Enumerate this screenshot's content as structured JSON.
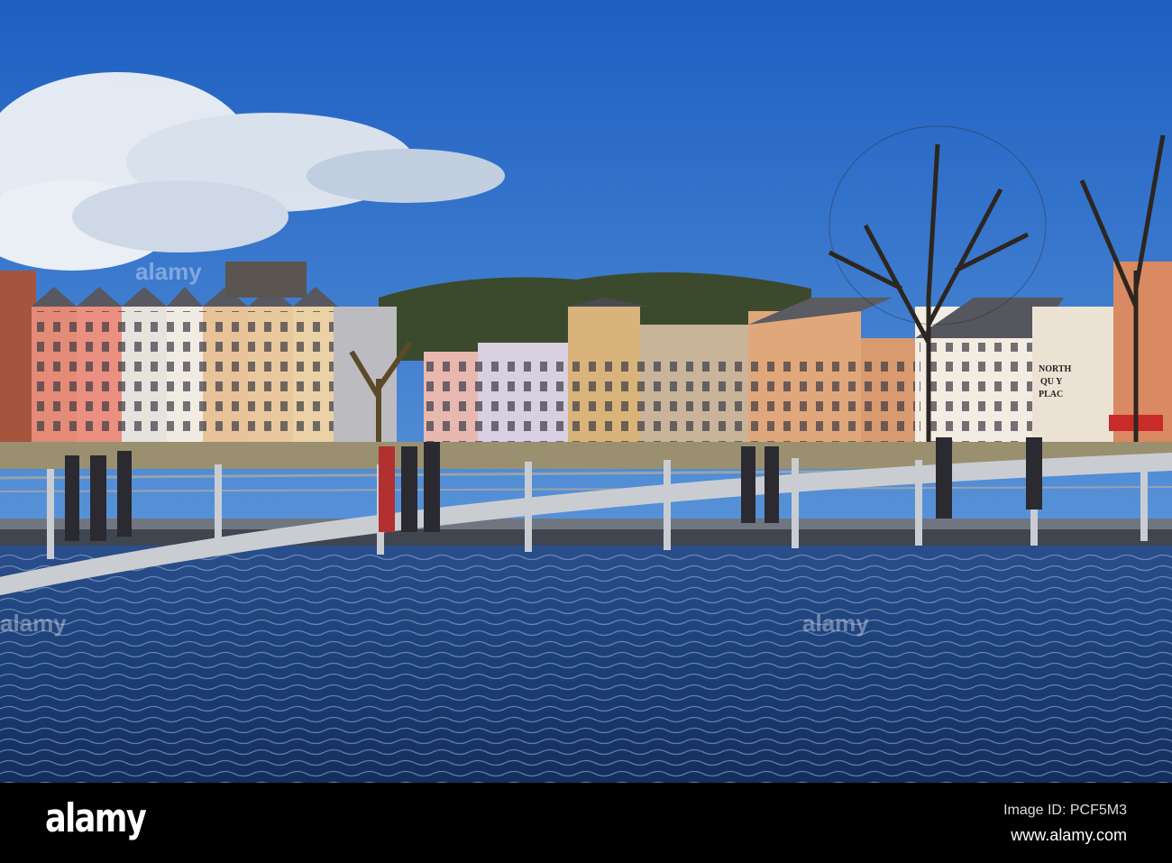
{
  "photo": {
    "subject": "River quay with footbridge and colourful terraced houses",
    "sign": {
      "line1": "NORTH",
      "line2": "QU Y",
      "line3": "PLAC"
    },
    "colors": {
      "sky_top": "#1f63c4",
      "sky_bottom": "#6aa6e0",
      "water": "#1a3f7a",
      "bridge": "#c9cdd2"
    }
  },
  "watermark": {
    "mark": "alamy"
  },
  "footer": {
    "logo": "alamy",
    "image_id": "Image ID: PCF5M3",
    "url": "www.alamy.com"
  }
}
